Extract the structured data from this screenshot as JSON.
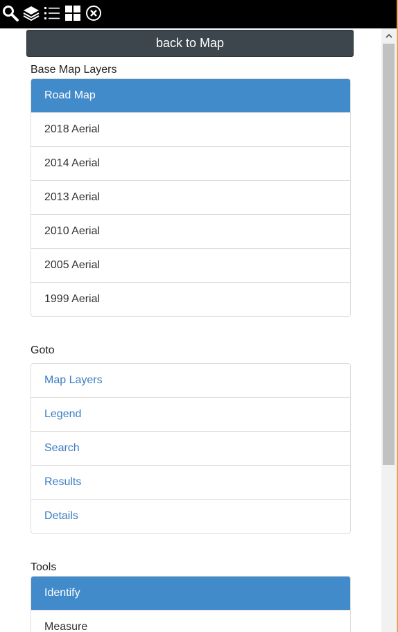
{
  "toolbar": {
    "icons": [
      "search-icon",
      "layers-icon",
      "list-icon",
      "grid-icon",
      "close-circle-icon"
    ]
  },
  "back_button": {
    "label": "back to Map"
  },
  "base_map": {
    "title": "Base Map Layers",
    "items": [
      {
        "label": "Road Map",
        "active": true
      },
      {
        "label": "2018 Aerial"
      },
      {
        "label": "2014 Aerial"
      },
      {
        "label": "2013 Aerial"
      },
      {
        "label": "2010 Aerial"
      },
      {
        "label": "2005 Aerial"
      },
      {
        "label": "1999 Aerial"
      }
    ]
  },
  "goto": {
    "title": "Goto",
    "items": [
      {
        "label": "Map Layers"
      },
      {
        "label": "Legend"
      },
      {
        "label": "Search"
      },
      {
        "label": "Results"
      },
      {
        "label": "Details"
      }
    ]
  },
  "tools": {
    "title": "Tools",
    "items": [
      {
        "label": "Identify",
        "active": true
      },
      {
        "label": "Measure"
      }
    ]
  },
  "colors": {
    "active": "#428bca",
    "link": "#3a7cc2",
    "back_button": "#3d464d",
    "toolbar": "#000000"
  }
}
